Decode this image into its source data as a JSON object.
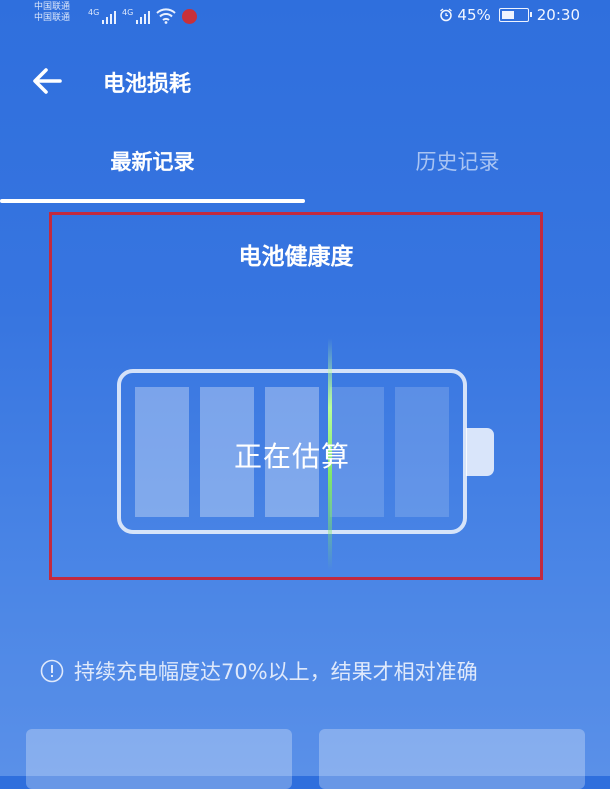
{
  "status_bar": {
    "carrier_1": "中国联通",
    "carrier_2": "中国联通",
    "network_type": "4G",
    "battery_percent": "45%",
    "battery_level": 0.45,
    "time": "20:30",
    "icons": [
      "signal-icon",
      "wifi-icon",
      "notification-icon",
      "alarm-icon",
      "battery-icon"
    ]
  },
  "header": {
    "title": "电池损耗",
    "back_icon": "back-arrow-icon"
  },
  "tabs": [
    {
      "label": "最新记录",
      "active": true
    },
    {
      "label": "历史记录",
      "active": false
    }
  ],
  "health": {
    "title": "电池健康度",
    "status": "正在估算"
  },
  "tip": {
    "icon": "info-icon",
    "text": "持续充电幅度达70%以上，结果才相对准确"
  },
  "colors": {
    "background": "#3775e0",
    "highlight_border": "#c22a3f",
    "scan_line": "#7fe66a"
  }
}
